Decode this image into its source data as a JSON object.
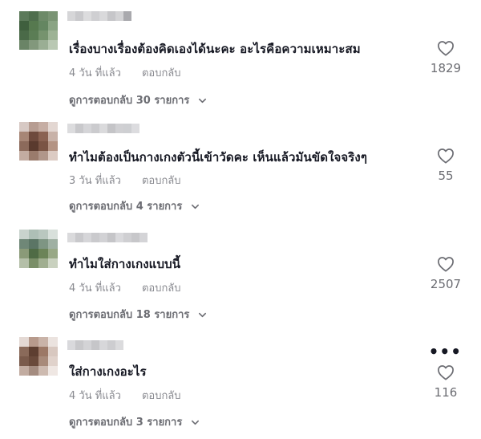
{
  "comments": [
    {
      "text": "เรื่องบางเรื่องต้องคิดเองได้นะคะ อะไรคือความเหมาะสม",
      "time": "4 วัน ที่แล้ว",
      "reply_label": "ตอบกลับ",
      "view_replies": "ดูการตอบกลับ 30 รายการ",
      "likes": "1829"
    },
    {
      "text": "ทำไมต้องเป็นกางเกงตัวนี้เข้าวัดคะ เห็นแล้วมันขัดใจจริงๆ",
      "time": "3 วัน ที่แล้ว",
      "reply_label": "ตอบกลับ",
      "view_replies": "ดูการตอบกลับ 4 รายการ",
      "likes": "55"
    },
    {
      "text": "ทำไมใส่กางเกงแบบนี้",
      "time": "4 วัน ที่แล้ว",
      "reply_label": "ตอบกลับ",
      "view_replies": "ดูการตอบกลับ 18 รายการ",
      "likes": "2507"
    },
    {
      "text": "ใส่กางเกงอะไร",
      "time": "4 วัน ที่แล้ว",
      "reply_label": "ตอบกลับ",
      "view_replies": "ดูการตอบกลับ 3 รายการ",
      "likes": "116",
      "more_label": "•••"
    }
  ],
  "icons": {
    "like": "heart-outline-icon",
    "expand": "chevron-down-icon",
    "more": "more-options-icon"
  },
  "colors": {
    "text": "#161823",
    "secondary": "#8a8b91",
    "heart_stroke": "#6c6d73"
  }
}
